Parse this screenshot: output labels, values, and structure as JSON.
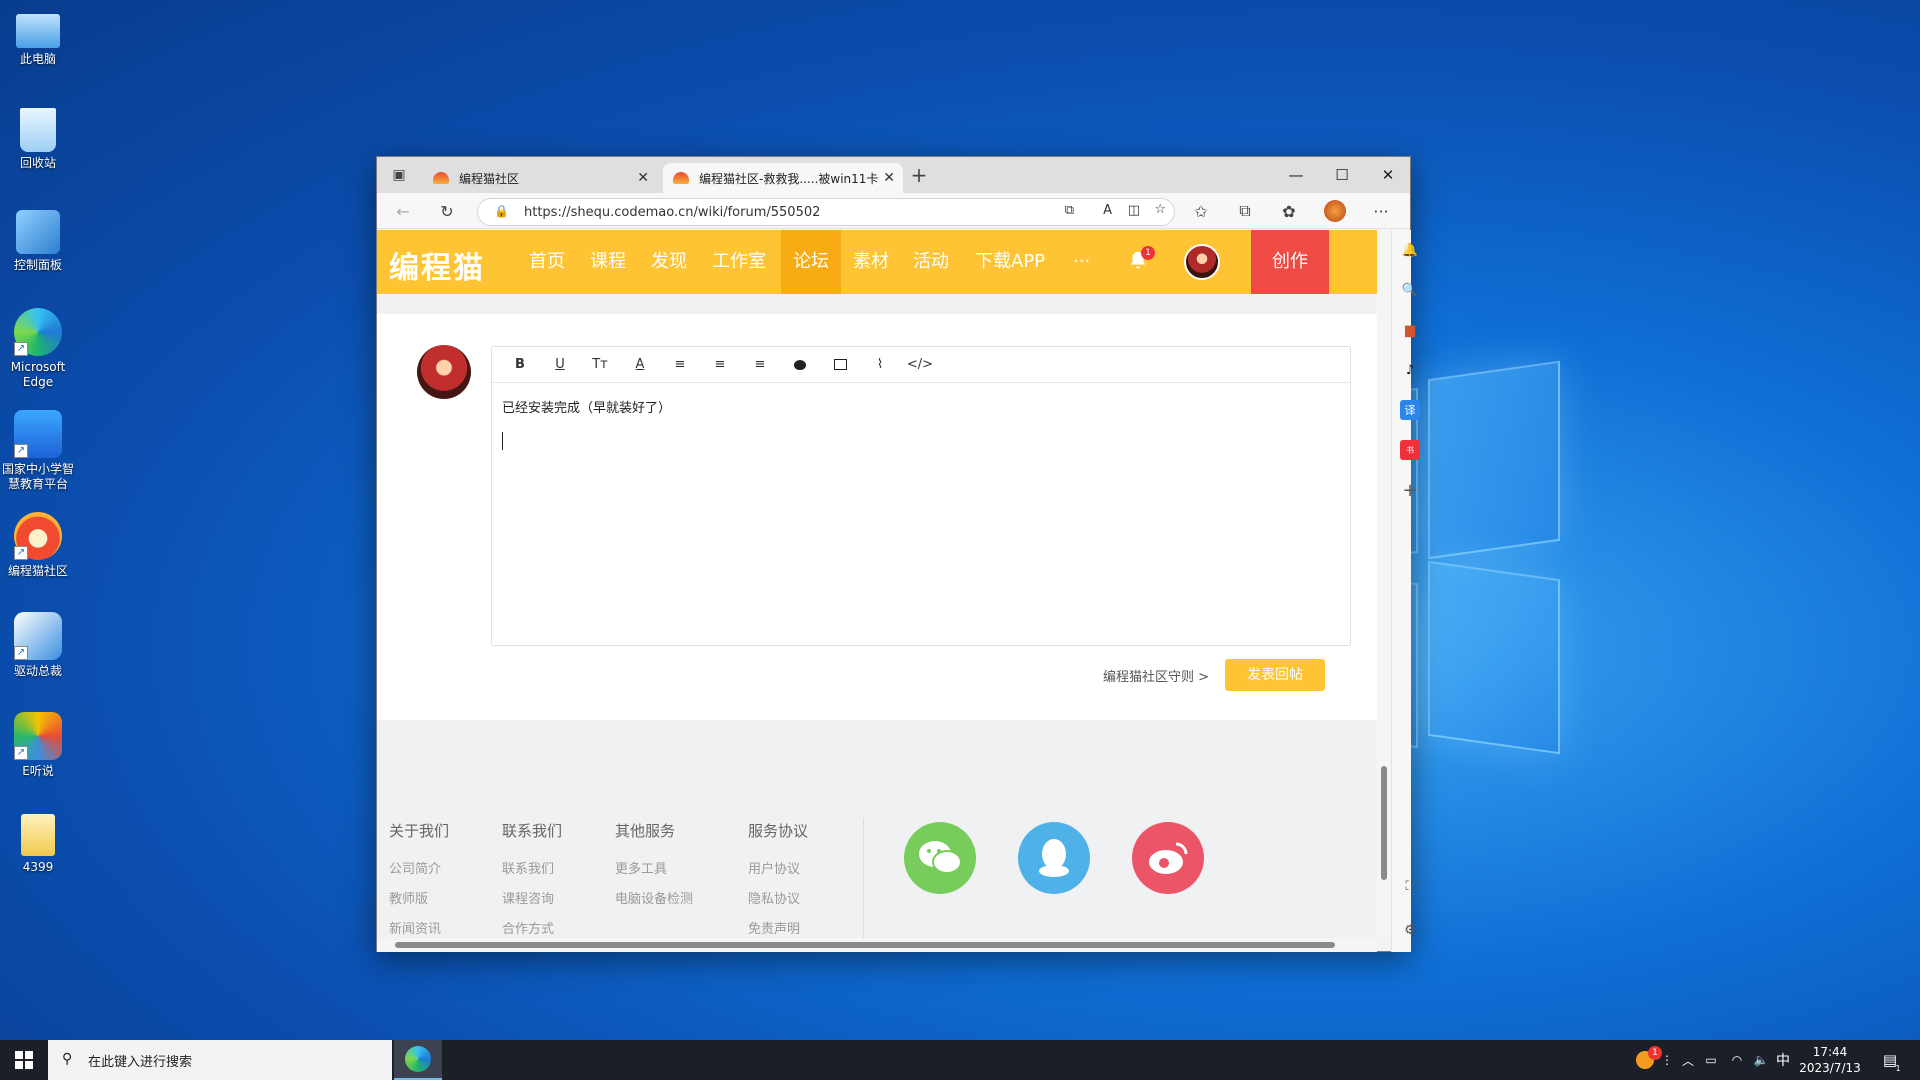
{
  "desktop": {
    "icons": [
      {
        "label": "此电脑"
      },
      {
        "label": "回收站"
      },
      {
        "label": "控制面板"
      },
      {
        "label": "Microsoft Edge"
      },
      {
        "label": "国家中小学智慧教育平台"
      },
      {
        "label": "编程猫社区"
      },
      {
        "label": "驱动总裁"
      },
      {
        "label": "E听说"
      },
      {
        "label": "4399"
      }
    ]
  },
  "browser": {
    "tabs": [
      {
        "title": "编程猫社区",
        "active": false
      },
      {
        "title": "编程猫社区-救救我.....被win11卡!",
        "active": true
      }
    ],
    "new_tab_label": "+",
    "url": "https://shequ.codemao.cn/wiki/forum/550502",
    "controls": {
      "minimize": "—",
      "maximize": "☐",
      "close": "✕"
    }
  },
  "site": {
    "logo": "编程猫",
    "nav": [
      "首页",
      "课程",
      "发现",
      "工作室",
      "论坛",
      "素材",
      "活动",
      "下载APP",
      "···"
    ],
    "active_nav": "论坛",
    "notification_count": "1",
    "create_label": "创作",
    "accent": "#fec433",
    "create_color": "#ee4b44"
  },
  "reply": {
    "toolbar": [
      "B",
      "U",
      "Tт",
      "A",
      "≡",
      "≡",
      "≡",
      "cat",
      "img",
      "clip",
      "</>"
    ],
    "content": "已经安装完成（早就装好了）",
    "rules_link": "编程猫社区守则 >",
    "submit_label": "发表回帖"
  },
  "footer": {
    "columns": [
      {
        "heading": "关于我们",
        "links": [
          "公司简介",
          "教师版",
          "新闻资讯"
        ]
      },
      {
        "heading": "联系我们",
        "links": [
          "联系我们",
          "课程咨询",
          "合作方式"
        ]
      },
      {
        "heading": "其他服务",
        "links": [
          "更多工具",
          "电脑设备检测"
        ]
      },
      {
        "heading": "服务协议",
        "links": [
          "用户协议",
          "隐私协议",
          "免责声明"
        ]
      }
    ],
    "social": [
      {
        "name": "wechat-icon",
        "color": "#77cc5b"
      },
      {
        "name": "qq-icon",
        "color": "#4eb1e8"
      },
      {
        "name": "weibo-icon",
        "color": "#ec5467"
      }
    ]
  },
  "taskbar": {
    "search_placeholder": "在此键入进行搜索",
    "ime": "中",
    "time": "17:44",
    "date": "2023/7/13",
    "tray_badge": "1",
    "notification_badge": "1"
  }
}
